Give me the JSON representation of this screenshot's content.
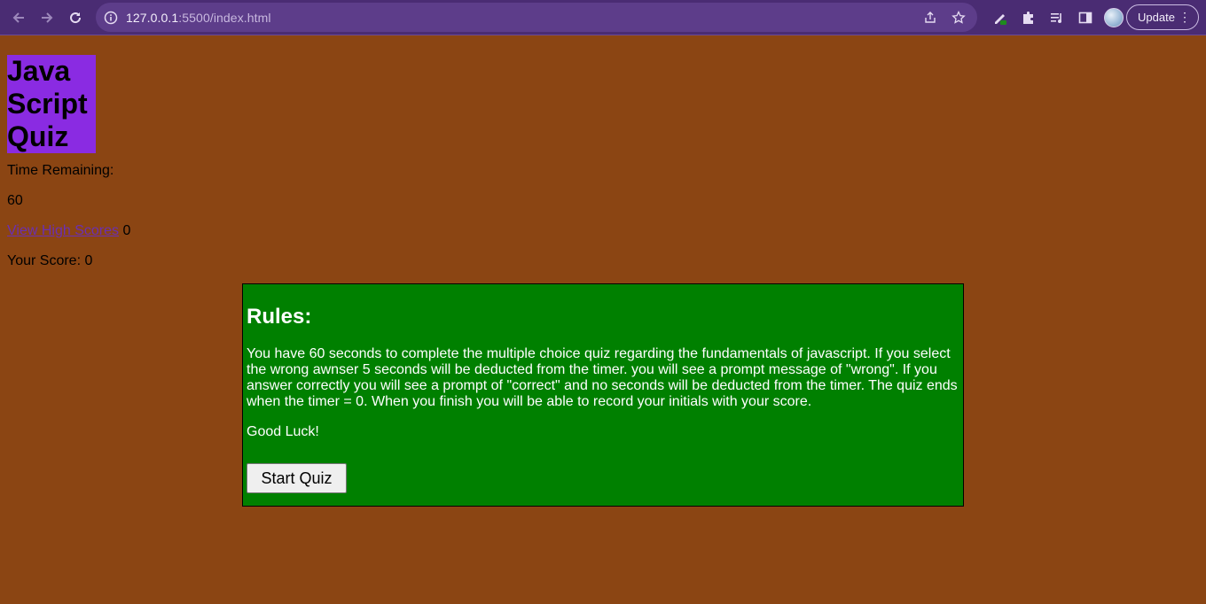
{
  "browser": {
    "url_host": "127.0.0.1",
    "url_path": ":5500/index.html",
    "update_label": "Update",
    "icons": [
      "back-icon",
      "forward-icon",
      "reload-icon",
      "info-icon",
      "share-icon",
      "star-icon",
      "extension-pen-icon",
      "puzzle-icon",
      "media-queue-icon",
      "sidepanel-icon",
      "avatar",
      "more-icon"
    ]
  },
  "page": {
    "title": "Java Script Quiz",
    "time_label": "Time Remaining:",
    "time_value": "60",
    "high_scores_link": "View High Scores",
    "high_scores_count": "0",
    "score_text": "Your Score: 0"
  },
  "rules": {
    "title": "Rules:",
    "text": "You have 60 seconds to complete the multiple choice quiz regarding the fundamentals of javascript. If you select the wrong awnser 5 seconds will be deducted from the timer. you will see a prompt message of \"wrong\". If you answer correctly you will see a prompt of \"correct\" and no seconds will be deducted from the timer. The quiz ends when the timer = 0. When you finish you will be able to record your initials with your score.",
    "good_luck": "Good Luck!",
    "start_button": "Start Quiz"
  },
  "colors": {
    "page_bg": "#8b4513",
    "title_bg": "#8a2be2",
    "rules_bg": "#008000",
    "chrome_bg": "#4a2c73"
  }
}
